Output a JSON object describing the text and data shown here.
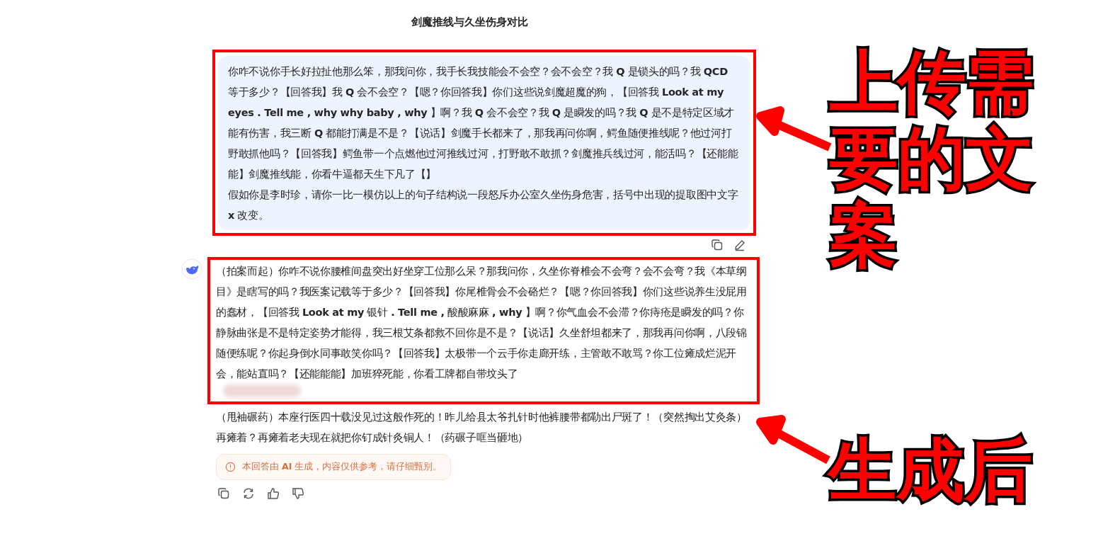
{
  "title": "剑魔推线与久坐伤身对比",
  "user_message": {
    "paragraphs": [
      "你咋不说你手长好拉扯他那么笨，那我问你，我手长我技能会不会空？会不会空？我 **Q** 是锁头的吗？我 **QCD** 等于多少？【回答我】我 **Q** 会不会空？【嗯？你回答我】你们这些说剑魔超魔的狗，【回答我 **Look at my eyes . Tell me , why why baby , why** 】啊？我 **Q** 会不会空？我 **Q** 是瞬发的吗？我 **Q** 是不是特定区域才能有伤害，我三断 **Q** 都能打满是不是？【说话】剑魔手长都来了，那我再问你啊，鳄鱼随便推线呢？他过河打野敢抓他吗？【回答我】鳄鱼带一个点燃他过河推线过河，打野敢不敢抓？剑魔推兵线过河，能活吗？【还能能能】剑魔推线能，你看牛逼都天生下凡了【】",
      "假如你是李时珍，请你一比一模仿以上的句子结构说一段怒斥办公室久坐伤身危害，括号中出现的提取图中文字 **x** 改变。"
    ]
  },
  "reply": {
    "paragraphs": [
      "（拍案而起）你咋不说你腰椎间盘突出好坐穿工位那么呆？那我问你，久坐你脊椎会不会弯？会不会弯？我《本草纲目》是瞎写的吗？我医案记载等于多少？【回答我】你尾椎骨会不会硌烂？【嗯？你回答我】你们这些说养生没屁用的蠢材，【回答我 **Look at my** 银针 **. Tell me ,** 酸酸麻麻 **, why** 】啊？你气血会不会滞？你痔疮是瞬发的吗？你静脉曲张是不是特定姿势才能得，我三根艾条都救不回你是不是？【说话】久坐舒坦都来了，那我再问你啊，八段锦随便练呢？你起身倒水同事敢笑你吗？【回答我】太极带一个云手你走廊开练，主管敢不敢骂？你工位瘫成烂泥开会，能站直吗？【还能能能】加班猝死能，你看工牌都自带坟头了",
      "（甩袖碾药）本座行医四十载没见过这般作死的！昨儿给县太爷扎针时他裤腰带都勒出尸斑了！（突然掏出艾灸条）再瘫着？再瘫着老夫现在就把你钉成针灸铜人！（药碾子哐当砸地）"
    ],
    "notice": "本回答由 **AI** 生成，内容仅供参考，请仔细甄别。"
  },
  "annotations": [
    {
      "text": "上传需要的文案"
    },
    {
      "text": "生成后"
    }
  ]
}
